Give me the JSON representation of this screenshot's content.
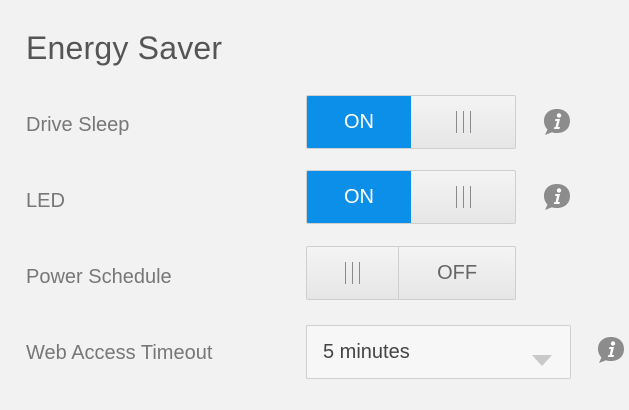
{
  "panel": {
    "title": "Energy Saver"
  },
  "settings": {
    "drive_sleep": {
      "label": "Drive Sleep",
      "on_label": "ON",
      "state": "on"
    },
    "led": {
      "label": "LED",
      "on_label": "ON",
      "state": "on"
    },
    "power_schedule": {
      "label": "Power Schedule",
      "off_label": "OFF",
      "state": "off"
    },
    "web_access_timeout": {
      "label": "Web Access Timeout",
      "selected": "5 minutes"
    }
  },
  "icons": {
    "info": "info-icon",
    "grip": "grip-icon",
    "dropdown": "chevron-down-icon"
  },
  "colors": {
    "accent": "#0b8fe8",
    "info_icon": "#8c8c8c",
    "background": "#f2f2f2"
  }
}
